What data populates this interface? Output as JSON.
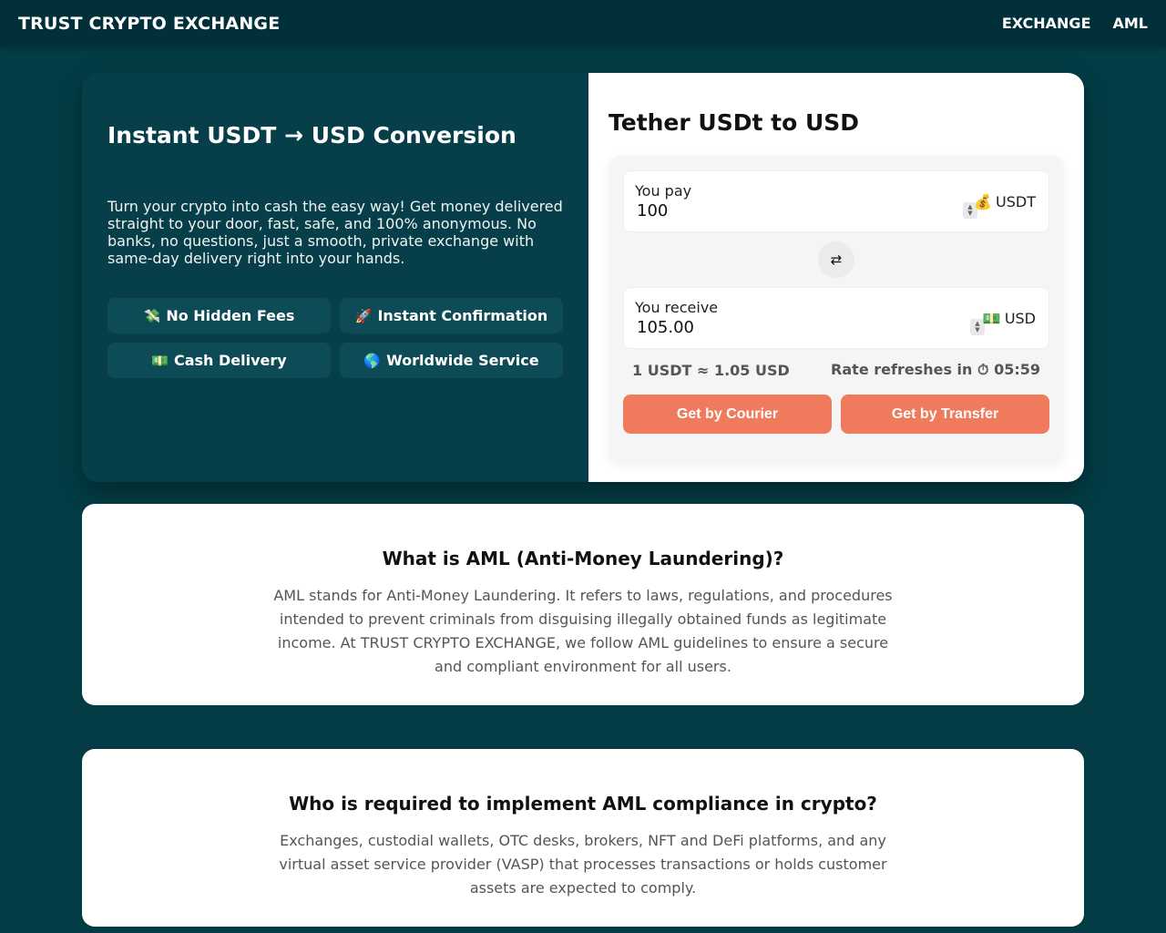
{
  "header": {
    "brand": "TRUST CRYPTO EXCHANGE",
    "nav": [
      {
        "label": "EXCHANGE"
      },
      {
        "label": "AML"
      }
    ]
  },
  "hero": {
    "title": "Instant USDT → USD Conversion",
    "text": "Turn your crypto into cash the easy way! Get money delivered straight to your door, fast, safe, and 100% anonymous. No banks, no questions, just a smooth, private exchange with same-day delivery right into your hands.",
    "features": [
      {
        "emoji": "💸",
        "label": "No Hidden Fees"
      },
      {
        "emoji": "🚀",
        "label": "Instant Confirmation"
      },
      {
        "emoji": "💵",
        "label": "Cash Delivery"
      },
      {
        "emoji": "🌎",
        "label": "Worldwide Service"
      }
    ]
  },
  "converter": {
    "title": "Tether USDt to USD",
    "pay": {
      "label": "You pay",
      "value": "100",
      "currency_emoji": "💰",
      "currency": "USDT"
    },
    "swap_icon": "⇄",
    "receive": {
      "label": "You receive",
      "value": "105.00",
      "currency_emoji": "💵",
      "currency": "USD"
    },
    "rate": "1 USDT ≈ 1.05 USD",
    "refresh_label": "Rate refreshes in",
    "timer_icon": "⏱",
    "refresh_time": "05:59",
    "buttons": {
      "courier": "Get by Courier",
      "transfer": "Get by Transfer"
    },
    "colors": {
      "accent": "#f07b5c"
    }
  },
  "sections": [
    {
      "title": "What is AML (Anti-Money Laundering)?",
      "text": "AML stands for Anti-Money Laundering. It refers to laws, regulations, and procedures intended to prevent criminals from disguising illegally obtained funds as legitimate income. At TRUST CRYPTO EXCHANGE, we follow AML guidelines to ensure a secure and compliant environment for all users."
    },
    {
      "title": "Who is required to implement AML compliance in crypto?",
      "text": "Exchanges, custodial wallets, OTC desks, brokers, NFT and DeFi platforms, and any virtual asset service provider (VASP) that processes transactions or holds customer assets are expected to comply."
    }
  ]
}
